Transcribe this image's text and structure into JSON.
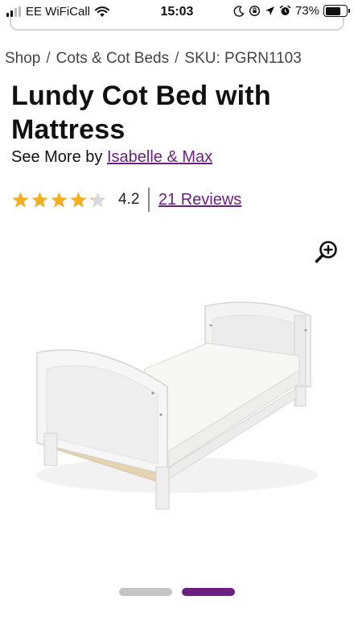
{
  "status_bar": {
    "carrier": "EE WiFiCall",
    "time": "15:03",
    "battery": "73%",
    "battery_level": 0.73
  },
  "breadcrumb": {
    "items": [
      "Shop",
      "Cots & Cot Beds",
      "SKU: PGRN1103"
    ],
    "separator": "/"
  },
  "product": {
    "title": "Lundy Cot Bed with Mattress",
    "see_more_prefix": "See More by",
    "brand": "Isabelle & Max",
    "rating": "4.2",
    "rating_value": 4.2,
    "rating_max": 5,
    "reviews": "21 Reviews"
  },
  "gallery": {
    "slides": 2,
    "active_slide": 2
  },
  "colors": {
    "accent": "#6b1f7e",
    "star": "#f2b01e",
    "star_empty": "#d9d9d9",
    "pager_inactive": "#c4c4c4"
  },
  "icons": [
    "signal-icon",
    "wifi-icon",
    "moon-icon",
    "location-arrow-icon",
    "alarm-icon",
    "battery-icon",
    "zoom-in-icon",
    "star-icon"
  ]
}
